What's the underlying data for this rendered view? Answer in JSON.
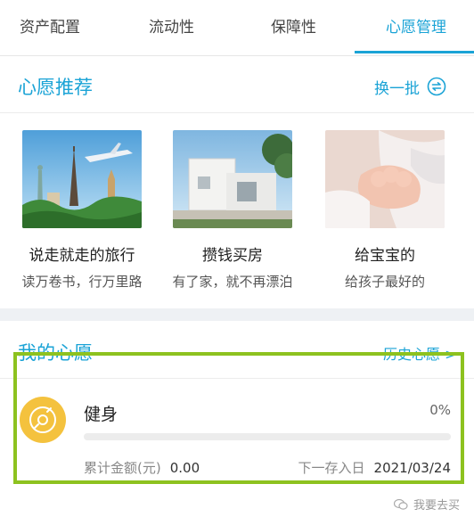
{
  "tabs": [
    {
      "label": "资产配置"
    },
    {
      "label": "流动性"
    },
    {
      "label": "保障性"
    },
    {
      "label": "心愿管理"
    }
  ],
  "recommend": {
    "title": "心愿推荐",
    "refresh_label": "换一批",
    "cards": [
      {
        "title": "说走就走的旅行",
        "subtitle": "读万卷书，行万里路",
        "image": "travel-landmarks"
      },
      {
        "title": "攒钱买房",
        "subtitle": "有了家，就不再漂泊",
        "image": "white-house"
      },
      {
        "title": "给宝宝的",
        "subtitle": "给孩子最好的",
        "image": "baby-hand"
      }
    ]
  },
  "my_wishes": {
    "title": "我的心愿",
    "history_label": "历史心愿 >",
    "wish": {
      "name": "健身",
      "percent_text": "0%",
      "progress": 0,
      "accum_label": "累计金额(元)",
      "accum_value": "0.00",
      "next_label": "下一存入日",
      "next_value": "2021/03/24"
    }
  },
  "watermark": {
    "text": "我要去买"
  },
  "colors": {
    "accent": "#1aa3d6",
    "highlight": "#8dc21f",
    "wish_icon": "#f4c23e"
  }
}
